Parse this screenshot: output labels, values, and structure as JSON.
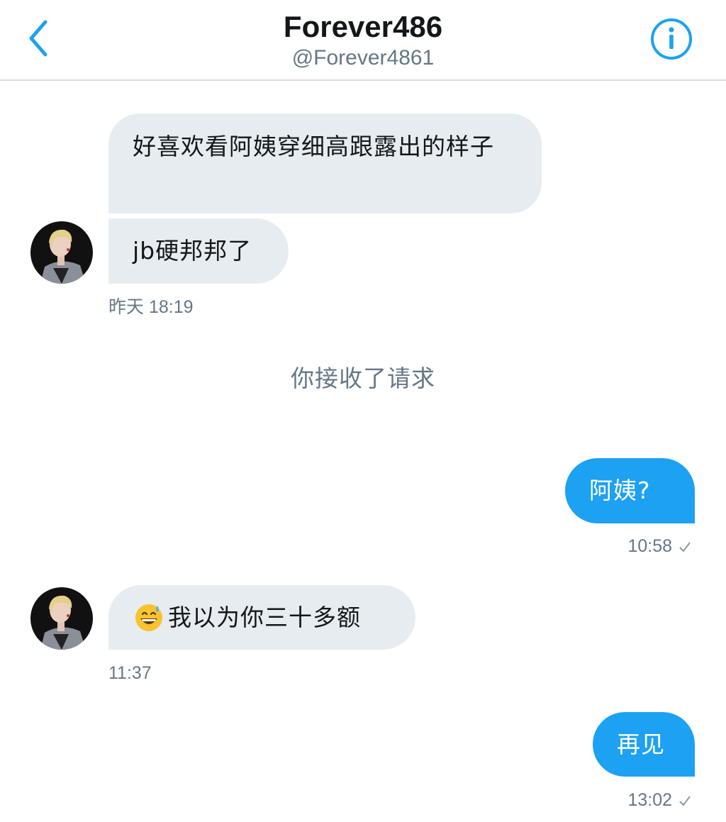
{
  "header": {
    "title": "Forever486",
    "handle": "@Forever4861",
    "back_icon": "chevron-left-icon",
    "info_icon": "info-circle-icon"
  },
  "colors": {
    "accent": "#1da1f2",
    "incoming_bubble": "#e6ecf0",
    "secondary_text": "#657786",
    "divider": "#d9dde1"
  },
  "messages": [
    {
      "direction": "incoming",
      "text": "好喜欢看阿姨穿细高跟露出的样子"
    },
    {
      "direction": "incoming",
      "text": "jb硬邦邦了",
      "time": "昨天 18:19"
    },
    {
      "direction": "system",
      "text": "你接收了请求"
    },
    {
      "direction": "outgoing",
      "text": "阿姨?",
      "time": "10:58",
      "status_icon": "checkmark-icon"
    },
    {
      "direction": "incoming",
      "emoji": "grinning-sweat-emoji",
      "text": "我以为你三十多额",
      "time": "11:37"
    },
    {
      "direction": "outgoing",
      "text": "再见",
      "time": "13:02",
      "status_icon": "checkmark-icon"
    }
  ]
}
